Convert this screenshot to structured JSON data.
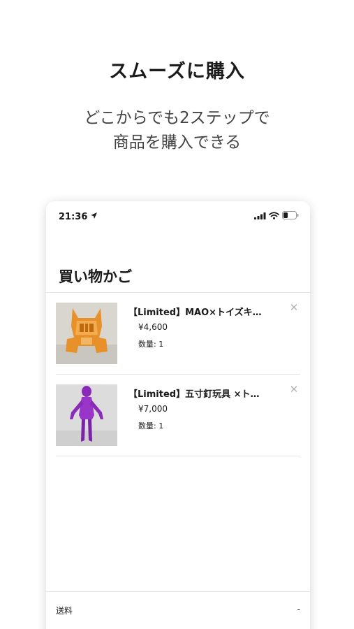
{
  "promo": {
    "headline": "スムーズに購入",
    "subline_1": "どこからでも2ステップで",
    "subline_2": "商品を購入できる"
  },
  "status_bar": {
    "time": "21:36",
    "icons": [
      "location-arrow-icon",
      "cellular-signal-icon",
      "wifi-icon",
      "battery-icon"
    ]
  },
  "cart": {
    "title": "買い物かご",
    "items": [
      {
        "name": "【Limited】MAO×トイズキ…",
        "price": "¥4,600",
        "quantity": "数量: 1",
        "thumbnail": "orange-clear-vinyl-figure-head",
        "remove_icon": "close-icon"
      },
      {
        "name": "【Limited】五寸釘玩具 ×ト…",
        "price": "¥7,000",
        "quantity": "数量: 1",
        "thumbnail": "purple-vinyl-figure",
        "remove_icon": "close-icon"
      }
    ]
  },
  "summary": {
    "shipping_label": "送料",
    "shipping_value": "-"
  },
  "colors": {
    "background": "#ffffff",
    "text": "#1a1a1a",
    "divider": "#e4e4e4",
    "remove_icon": "#b5b5b5"
  }
}
